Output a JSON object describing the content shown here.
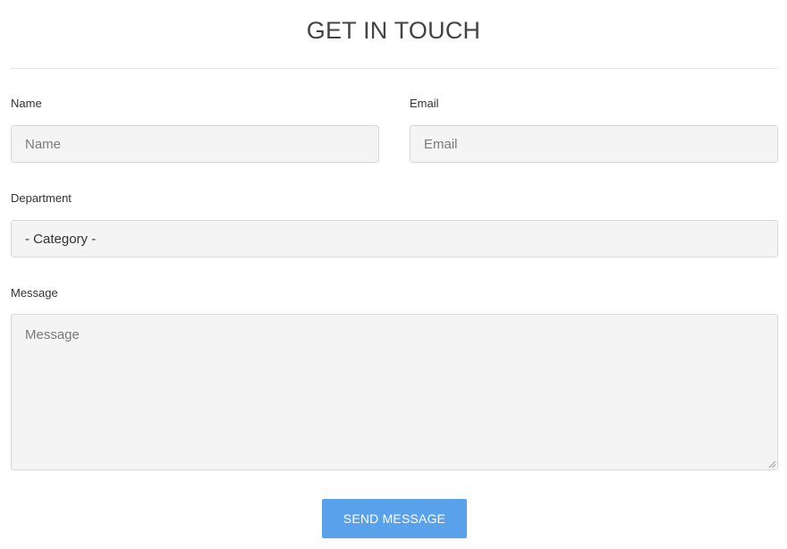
{
  "header": {
    "title": "GET IN TOUCH"
  },
  "form": {
    "name": {
      "label": "Name",
      "placeholder": "Name",
      "value": ""
    },
    "email": {
      "label": "Email",
      "placeholder": "Email",
      "value": ""
    },
    "department": {
      "label": "Department",
      "selected": "- Category -"
    },
    "message": {
      "label": "Message",
      "placeholder": "Message",
      "value": ""
    },
    "submit_label": "SEND MESSAGE"
  },
  "colors": {
    "accent": "#59a1eb",
    "field_background": "#f4f4f4",
    "field_border": "#d9d9d9",
    "title_text": "#444444"
  },
  "icons": {
    "textarea_resize": "resize-handle-icon"
  }
}
